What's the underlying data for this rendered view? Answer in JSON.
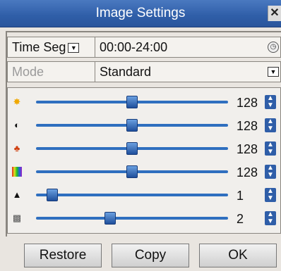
{
  "window": {
    "title": "Image Settings",
    "close_glyph": "✕"
  },
  "time_seg": {
    "label": "Time Seg",
    "value": "00:00-24:00"
  },
  "mode": {
    "label": "Mode",
    "value": "Standard"
  },
  "sliders": [
    {
      "name": "brightness",
      "icon": "sun-icon",
      "value": "128",
      "level": 0.5
    },
    {
      "name": "contrast",
      "icon": "contrast-icon",
      "value": "128",
      "level": 0.5
    },
    {
      "name": "saturation",
      "icon": "saturation-icon",
      "value": "128",
      "level": 0.5
    },
    {
      "name": "hue",
      "icon": "hue-icon",
      "value": "128",
      "level": 0.5
    },
    {
      "name": "sharpness",
      "icon": "sharpness-icon",
      "value": "1",
      "level": 0.06
    },
    {
      "name": "noise-reduction",
      "icon": "noise-icon",
      "value": "2",
      "level": 0.38
    }
  ],
  "buttons": {
    "restore": "Restore",
    "copy": "Copy",
    "ok": "OK"
  },
  "colors": {
    "accent": "#2f6fbf",
    "title_bar": "#2f5ea8"
  }
}
